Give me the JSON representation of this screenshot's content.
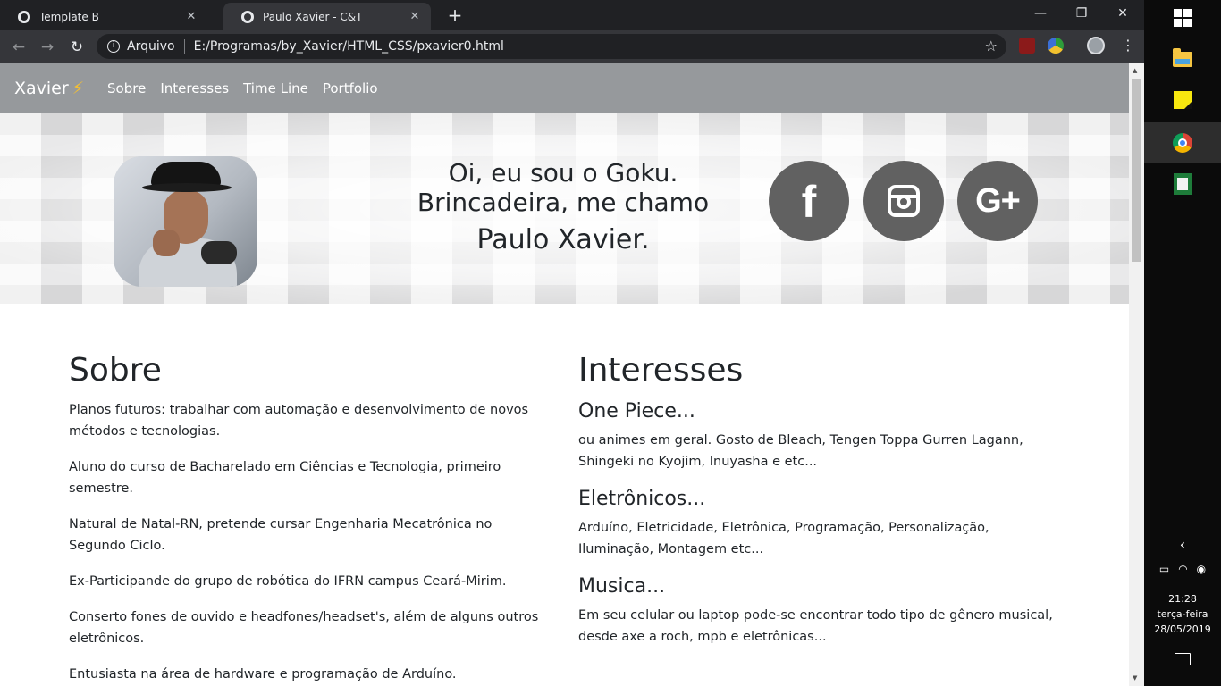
{
  "browser": {
    "tabs": [
      {
        "title": "Template B",
        "active": false
      },
      {
        "title": "Paulo Xavier - C&T",
        "active": true
      }
    ],
    "new_tab_glyph": "+",
    "window_controls": {
      "minimize": "—",
      "restore": "❐",
      "close": "✕"
    },
    "nav": {
      "back": "←",
      "forward": "→",
      "reload": "↻"
    },
    "address": {
      "scheme_label": "Arquivo",
      "url": "E:/Programas/by_Xavier/HTML_CSS/pxavier0.html"
    },
    "icons": [
      "info-icon",
      "star-icon",
      "ublock-icon",
      "extension-icon",
      "profile-icon",
      "menu-icon"
    ]
  },
  "site": {
    "brand": "Xavier",
    "brand_icon": "⚡",
    "nav_links": [
      "Sobre",
      "Interesses",
      "Time Line",
      "Portfolio"
    ],
    "hero": {
      "line1": "Oi, eu sou o Goku.",
      "line2": "Brincadeira, me chamo",
      "name": "Paulo Xavier."
    },
    "social": [
      {
        "name": "facebook",
        "glyph": "f"
      },
      {
        "name": "instagram",
        "glyph": ""
      },
      {
        "name": "google-plus",
        "glyph": "G+"
      }
    ],
    "sobre": {
      "title": "Sobre",
      "paragraphs": [
        "Planos futuros: trabalhar com automação e desenvolvimento de novos métodos e tecnologias.",
        "Aluno do curso de Bacharelado em Ciências e Tecnologia, primeiro semestre.",
        "Natural de Natal-RN, pretende cursar Engenharia Mecatrônica no Segundo Ciclo.",
        "Ex-Participande do grupo de robótica do IFRN campus Ceará-Mirim.",
        "Conserto fones de ouvido e headfones/headset's, além de alguns outros eletrônicos.",
        "Entusiasta na área de hardware e programação de Arduíno."
      ]
    },
    "interesses": {
      "title": "Interesses",
      "items": [
        {
          "heading": "One Piece...",
          "text": "ou animes em geral. Gosto de Bleach, Tengen Toppa Gurren Lagann, Shingeki no Kyojim, Inuyasha e etc..."
        },
        {
          "heading": "Eletrônicos...",
          "text": "Arduíno, Eletricidade, Eletrônica, Programação, Personalização, Iluminação, Montagem etc..."
        },
        {
          "heading": "Musica...",
          "text": "Em seu celular ou laptop pode-se encontrar todo tipo de gênero musical, desde axe a roch, mpb e eletrônicas..."
        }
      ]
    }
  },
  "taskbar": {
    "pinned": [
      "windows-start-icon",
      "file-explorer-icon",
      "sticky-notes-icon",
      "chrome-icon",
      "spreadsheet-icon"
    ],
    "tray": {
      "chevron": "‹",
      "time": "21:28",
      "weekday": "terça-feira",
      "date": "28/05/2019"
    }
  },
  "colors": {
    "navbar": "#96999c",
    "social_circle": "#616161",
    "text": "#212529",
    "brand_bolt": "#f6c02f"
  }
}
